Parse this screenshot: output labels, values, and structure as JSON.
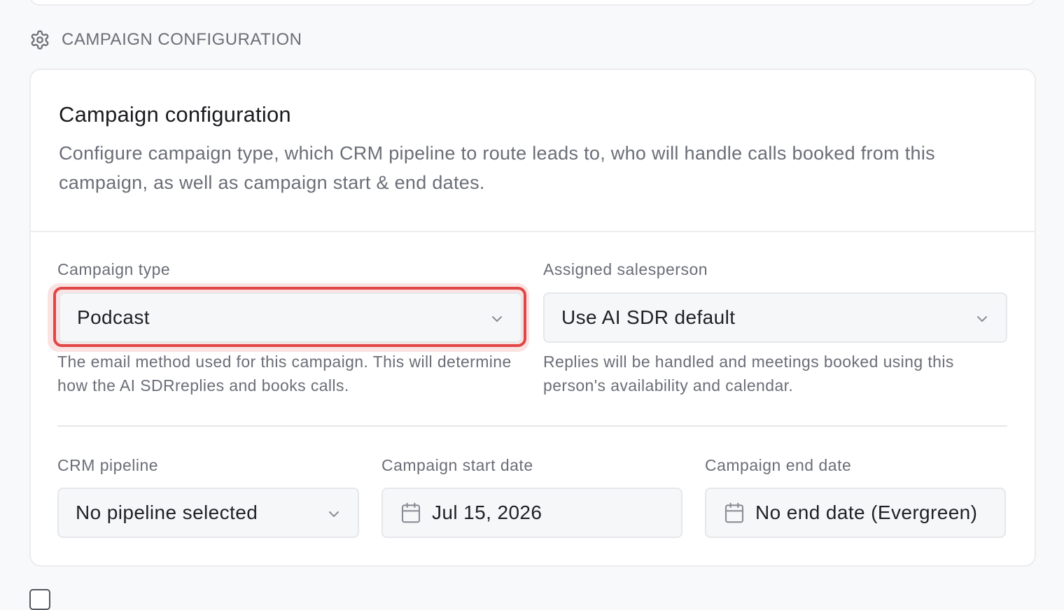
{
  "section": {
    "title": "CAMPAIGN CONFIGURATION",
    "icon": "gear-icon"
  },
  "card": {
    "title": "Campaign configuration",
    "description": "Configure campaign type, which CRM pipeline to route leads to, who will handle calls booked from this campaign, as well as campaign start & end dates."
  },
  "campaign_type": {
    "label": "Campaign type",
    "value": "Podcast",
    "help": "The email method used for this campaign. This will determine how the AI SDRreplies and books calls.",
    "highlight_color": "#e04747"
  },
  "assigned_salesperson": {
    "label": "Assigned salesperson",
    "value": "Use AI SDR default",
    "help": "Replies will be handled and meetings booked using this person's availability and calendar."
  },
  "crm_pipeline": {
    "label": "CRM pipeline",
    "value": "No pipeline selected"
  },
  "start_date": {
    "label": "Campaign start date",
    "value": "Jul 15, 2026"
  },
  "end_date": {
    "label": "Campaign end date",
    "value": "No end date (Evergreen)"
  }
}
